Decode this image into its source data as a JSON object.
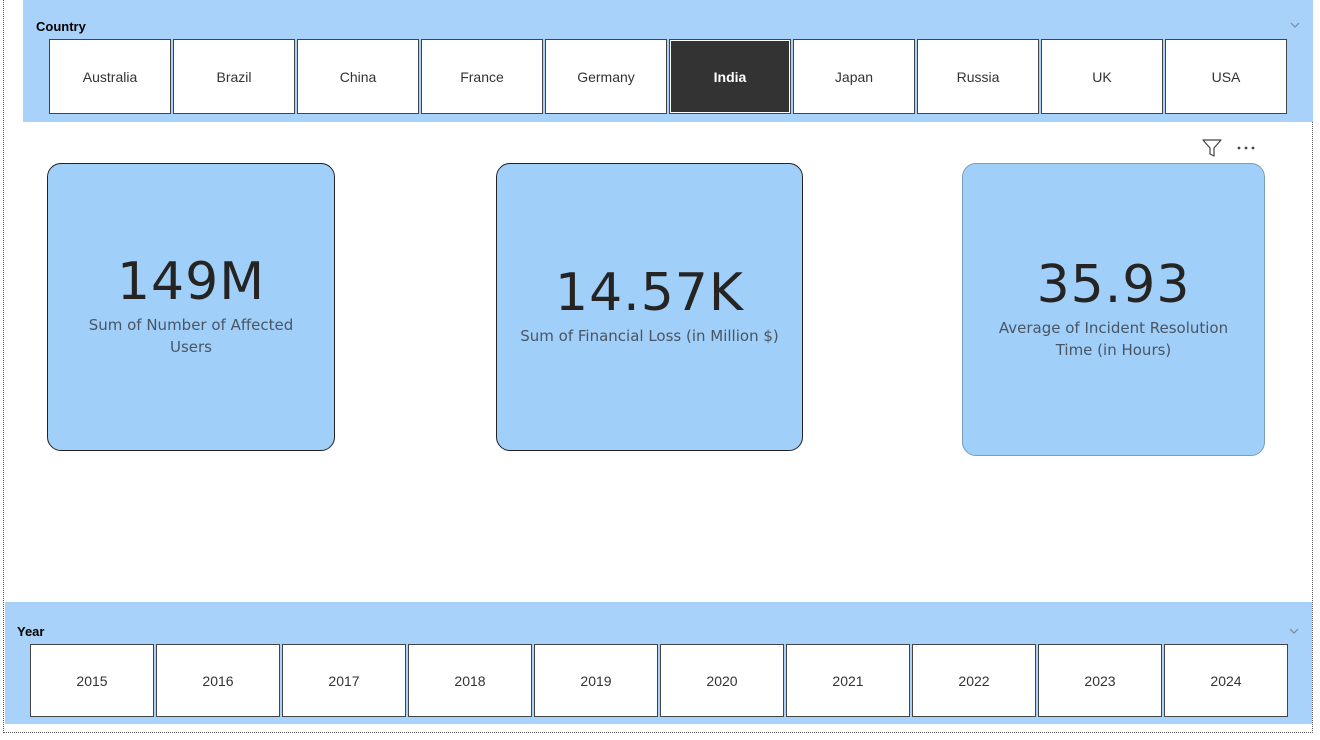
{
  "country_slicer": {
    "title": "Country",
    "items": [
      "Australia",
      "Brazil",
      "China",
      "France",
      "Germany",
      "India",
      "Japan",
      "Russia",
      "UK",
      "USA"
    ],
    "selected": "India"
  },
  "cards": [
    {
      "value": "149M",
      "label": "Sum of Number of Affected Users"
    },
    {
      "value": "14.57K",
      "label": "Sum of Financial Loss (in Million $)"
    },
    {
      "value": "35.93",
      "label": "Average of Incident Resolution Time (in Hours)"
    }
  ],
  "visual_header": {
    "icons": [
      "filter-icon",
      "more-options-icon"
    ]
  },
  "year_slicer": {
    "title": "Year",
    "items": [
      "2015",
      "2016",
      "2017",
      "2018",
      "2019",
      "2020",
      "2021",
      "2022",
      "2023",
      "2024"
    ]
  },
  "colors": {
    "slicer_bg": "#a8d2fa",
    "card_bg": "#a0cff9",
    "selected_tile": "#333333"
  }
}
